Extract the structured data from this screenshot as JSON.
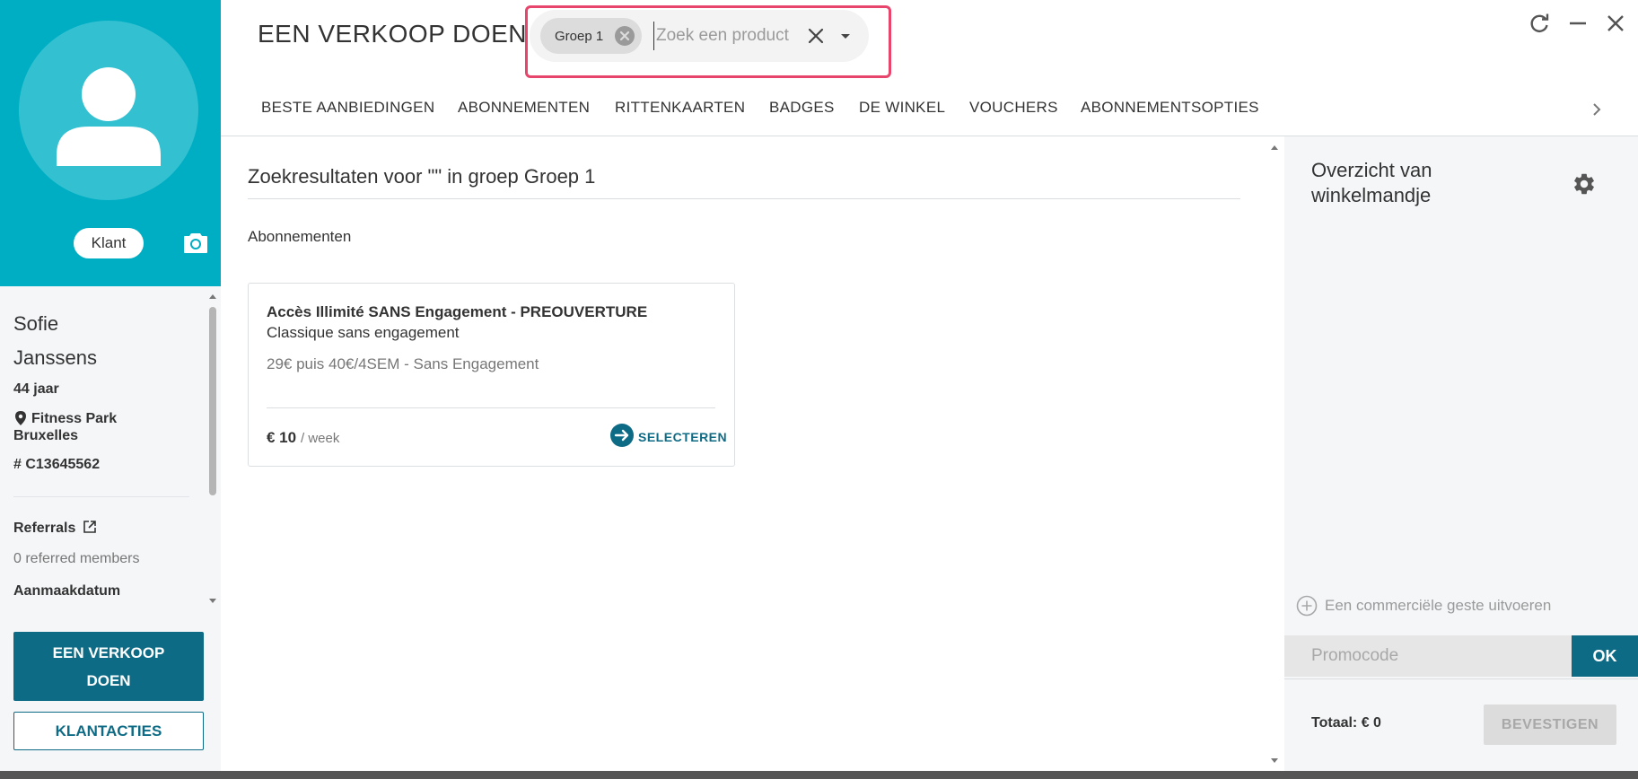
{
  "client": {
    "role": "Klant",
    "first_name": "Sofie",
    "last_name": "Janssens",
    "age": "44 jaar",
    "club": "Fitness Park Bruxelles",
    "id": "# C13645562",
    "referrals_label": "Referrals",
    "referred_count": "0 referred members",
    "created_label": "Aanmaakdatum"
  },
  "sidebar": {
    "sale_button": "EEN VERKOOP DOEN",
    "actions_button": "KLANTACTIES"
  },
  "header": {
    "title": "EEN VERKOOP DOEN",
    "search": {
      "chip": "Groep 1",
      "placeholder": "Zoek een product",
      "value": ""
    }
  },
  "tabs": [
    {
      "label": "BESTE AANBIEDINGEN"
    },
    {
      "label": "ABONNEMENTEN"
    },
    {
      "label": "RITTENKAARTEN"
    },
    {
      "label": "BADGES"
    },
    {
      "label": "DE WINKEL"
    },
    {
      "label": "VOUCHERS"
    },
    {
      "label": "ABONNEMENTSOPTIES"
    }
  ],
  "results": {
    "title": "Zoekresultaten voor \"\" in groep Groep 1",
    "section": "Abonnementen",
    "products": [
      {
        "name": "Accès Illimité SANS Engagement - PREOUVERTURE",
        "subtitle": "Classique sans engagement",
        "description": "29€ puis 40€/4SEM - Sans Engagement",
        "price": "€ 10",
        "unit": "/ week",
        "select_label": "SELECTEREN"
      }
    ]
  },
  "cart": {
    "title": "Overzicht van winkelmandje",
    "gesture_label": "Een commerciële geste uitvoeren",
    "promo_placeholder": "Promocode",
    "ok_label": "OK",
    "total": "Totaal: € 0",
    "confirm_label": "BEVESTIGEN"
  },
  "colors": {
    "brand_cyan": "#00aec3",
    "primary_teal": "#0e6b85",
    "highlight_pink": "#e8456c"
  },
  "icons": {
    "avatar": "user-silhouette-icon",
    "camera": "camera-icon",
    "location": "map-pin-icon",
    "external": "external-link-icon",
    "refresh": "refresh-icon",
    "minimize": "minimize-icon",
    "close": "close-icon",
    "chevron": "chevron-right-icon",
    "gear": "gear-icon"
  }
}
